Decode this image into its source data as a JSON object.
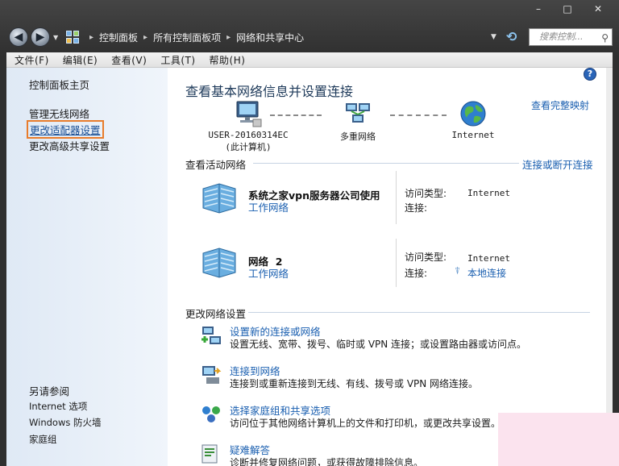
{
  "caption": {
    "minimize": "–",
    "maximize": "□",
    "close": "✕"
  },
  "nav": {
    "back": "◀",
    "forward": "▶",
    "dropdown": "▼"
  },
  "breadcrumbs": [
    "控制面板",
    "所有控制面板项",
    "网络和共享中心"
  ],
  "breadcrumb_sep": "▸",
  "search": {
    "placeholder": "搜索控制...",
    "icon": "search-icon"
  },
  "menu": [
    "文件(F)",
    "编辑(E)",
    "查看(V)",
    "工具(T)",
    "帮助(H)"
  ],
  "sidebar": {
    "home": "控制面板主页",
    "items": [
      "管理无线网络",
      "更改适配器设置",
      "更改高级共享设置"
    ],
    "selected_index": 1,
    "see_also_title": "另请参阅",
    "see_also": [
      "Internet 选项",
      "Windows 防火墙",
      "家庭组"
    ]
  },
  "main": {
    "help": "?",
    "heading": "查看基本网络信息并设置连接",
    "full_map": "查看完整映射",
    "map": {
      "computer": "USER-20160314EC",
      "computer_sub": "(此计算机)",
      "multi": "多重网络",
      "internet": "Internet"
    },
    "active_title": "查看活动网络",
    "connect_link": "连接或断开连接",
    "networks": [
      {
        "name": "系统之家vpn服务器公司使用",
        "type": "工作网络",
        "access_label": "访问类型:",
        "access_value": "Internet",
        "conn_label": "连接:",
        "conn_value": ""
      },
      {
        "name": "网络  2",
        "type": "工作网络",
        "access_label": "访问类型:",
        "access_value": "Internet",
        "conn_label": "连接:",
        "conn_value": "本地连接"
      }
    ],
    "change_title": "更改网络设置",
    "tasks": [
      {
        "title": "设置新的连接或网络",
        "desc": "设置无线、宽带、拨号、临时或 VPN 连接；或设置路由器或访问点。"
      },
      {
        "title": "连接到网络",
        "desc": "连接到或重新连接到无线、有线、拨号或 VPN 网络连接。"
      },
      {
        "title": "选择家庭组和共享选项",
        "desc": "访问位于其他网络计算机上的文件和打印机，或更改共享设置。"
      },
      {
        "title": "疑难解答",
        "desc": "诊断并修复网络问题，或获得故障排除信息。"
      }
    ]
  },
  "colors": {
    "link": "#1a5fb0",
    "highlight": "#e87c2c",
    "sidebar": "#dfe9f5"
  }
}
